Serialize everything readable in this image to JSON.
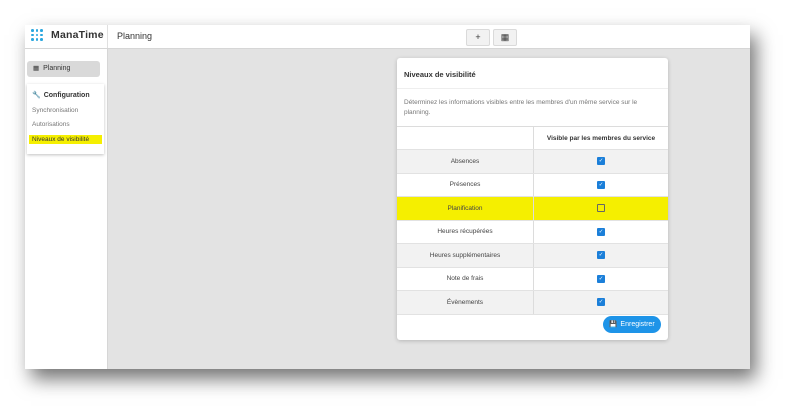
{
  "app": {
    "name": "ManaTime",
    "page_title": "Planning"
  },
  "toolbar": {
    "add_symbol": "+",
    "calendar_symbol": "▦"
  },
  "sidebar": {
    "planning_label": "Planning",
    "config_title": "Configuration",
    "links": [
      {
        "label": "Synchronisation"
      },
      {
        "label": "Autorisations"
      },
      {
        "label": "Niveaux de visibilité"
      }
    ],
    "active_link": "Niveaux de visibilité"
  },
  "card": {
    "title": "Niveaux de visibilité",
    "description": "Déterminez les informations visibles entre les membres d'un même service sur le planning.",
    "column_header": "Visible par les membres du service",
    "rows": [
      {
        "label": "Absences",
        "visible": true
      },
      {
        "label": "Présences",
        "visible": true
      },
      {
        "label": "Planification",
        "visible": false
      },
      {
        "label": "Heures récupérées",
        "visible": true
      },
      {
        "label": "Heures supplémentaires",
        "visible": true
      },
      {
        "label": "Note de frais",
        "visible": true
      },
      {
        "label": "Évènements",
        "visible": true
      }
    ],
    "highlighted_row": "Planification",
    "save_label": "Enregistrer"
  },
  "colors": {
    "accent": "#1e94e8",
    "highlight": "#f5ef00",
    "logo": "#2aa7df"
  }
}
